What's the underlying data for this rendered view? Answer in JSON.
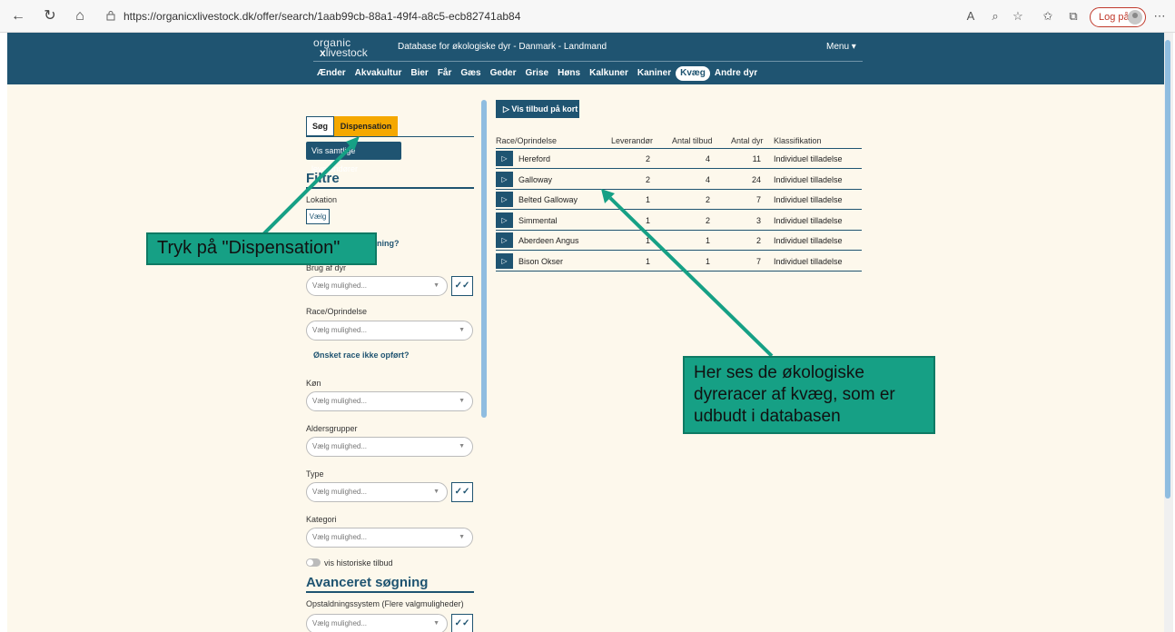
{
  "browser": {
    "url": "https://organicxlivestock.dk/offer/search/1aab99cb-88a1-49f4-a8c5-ecb82741ab84",
    "login_label": "Log på"
  },
  "header": {
    "logo_line1": "organic",
    "logo_x": "x",
    "logo_line2": "livestock",
    "title": "Database for økologiske dyr - Danmark - Landmand",
    "menu_label": "Menu ▾",
    "nav": [
      "Ænder",
      "Akvakultur",
      "Bier",
      "Får",
      "Gæs",
      "Geder",
      "Grise",
      "Høns",
      "Kalkuner",
      "Kaniner",
      "Kvæg",
      "Andre dyr"
    ],
    "active_nav": "Kvæg"
  },
  "filters": {
    "tab_search": "Søg",
    "tab_dispensation": "Dispensation",
    "show_all_button": "Vis samtlige leverandører",
    "heading": "Filtre",
    "location_label": "Lokation",
    "choose_button": "Vælg",
    "question_link": "ning?",
    "use_label": "Brug af dyr",
    "placeholder": "Vælg mulighed...",
    "breed_label": "Race/Oprindelse",
    "breed_missing_link": "Ønsket race ikke opført?",
    "sex_label": "Køn",
    "age_label": "Aldersgrupper",
    "type_label": "Type",
    "category_label": "Kategori",
    "history_toggle": "vis historiske tilbud",
    "advanced_heading": "Avanceret søgning",
    "housing_label": "Opstaldningssystem (Flere valgmuligheder)"
  },
  "results": {
    "map_button": "Vis tilbud på kort",
    "columns": [
      "Race/Oprindelse",
      "Leverandør",
      "Antal tilbud",
      "Antal dyr",
      "Klassifikation"
    ],
    "rows": [
      {
        "breed": "Hereford",
        "suppliers": "2",
        "offers": "4",
        "animals": "11",
        "class": "Individuel tilladelse"
      },
      {
        "breed": "Galloway",
        "suppliers": "2",
        "offers": "4",
        "animals": "24",
        "class": "Individuel tilladelse"
      },
      {
        "breed": "Belted Galloway",
        "suppliers": "1",
        "offers": "2",
        "animals": "7",
        "class": "Individuel tilladelse"
      },
      {
        "breed": "Simmental",
        "suppliers": "1",
        "offers": "2",
        "animals": "3",
        "class": "Individuel tilladelse"
      },
      {
        "breed": "Aberdeen Angus",
        "suppliers": "1",
        "offers": "1",
        "animals": "2",
        "class": "Individuel tilladelse"
      },
      {
        "breed": "Bison Okser",
        "suppliers": "1",
        "offers": "1",
        "animals": "7",
        "class": "Individuel tilladelse"
      }
    ]
  },
  "callouts": {
    "dispensation": "Tryk på \"Dispensation\"",
    "breeds_line1": "Her ses de økologiske",
    "breeds_line2": "dyreracer af kvæg, som er",
    "breeds_line3": "udbudt i databasen"
  },
  "colors": {
    "header_bg": "#1f5471",
    "page_bg": "#fdf8ec",
    "dispensation_tab": "#f5a800",
    "callout_bg": "#16a085"
  }
}
